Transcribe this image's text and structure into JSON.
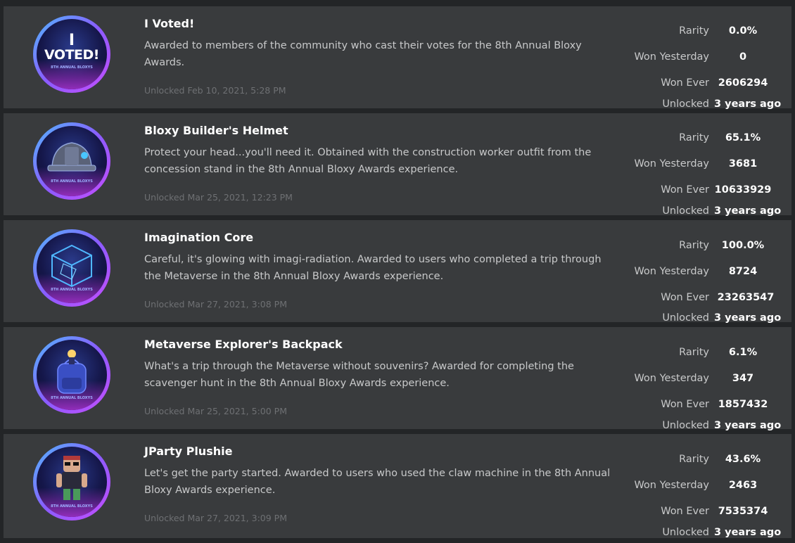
{
  "badges": [
    {
      "title": "I Voted!",
      "description": "Awarded to members of the community who cast their votes for the 8th Annual Bloxy Awards.",
      "unlocked_at": "Unlocked Feb 10, 2021, 5:28 PM",
      "icon": "voted-badge-icon",
      "icon_text_top": "I",
      "icon_text_main": "VOTED!",
      "icon_text_sub": "8TH ANNUAL BLOXYS",
      "stats": {
        "rarity_label": "Rarity",
        "rarity": "0.0%",
        "won_yesterday_label": "Won Yesterday",
        "won_yesterday": "0",
        "won_ever_label": "Won Ever",
        "won_ever": "2606294",
        "unlocked_label": "Unlocked",
        "unlocked": "3 years ago"
      }
    },
    {
      "title": "Bloxy Builder's Helmet",
      "description": "Protect your head...you'll need it. Obtained with the construction worker outfit from the concession stand in the 8th Annual Bloxy Awards experience.",
      "unlocked_at": "Unlocked Mar 25, 2021, 12:23 PM",
      "icon": "helmet-badge-icon",
      "icon_text_sub": "8TH ANNUAL BLOXYS",
      "stats": {
        "rarity_label": "Rarity",
        "rarity": "65.1%",
        "won_yesterday_label": "Won Yesterday",
        "won_yesterday": "3681",
        "won_ever_label": "Won Ever",
        "won_ever": "10633929",
        "unlocked_label": "Unlocked",
        "unlocked": "3 years ago"
      }
    },
    {
      "title": "Imagination Core",
      "description": "Careful, it's glowing with imagi-radiation. Awarded to users who completed a trip through the Metaverse in the 8th Annual Bloxy Awards experience.",
      "unlocked_at": "Unlocked Mar 27, 2021, 3:08 PM",
      "icon": "cube-badge-icon",
      "icon_text_sub": "8TH ANNUAL BLOXYS",
      "stats": {
        "rarity_label": "Rarity",
        "rarity": "100.0%",
        "won_yesterday_label": "Won Yesterday",
        "won_yesterday": "8724",
        "won_ever_label": "Won Ever",
        "won_ever": "23263547",
        "unlocked_label": "Unlocked",
        "unlocked": "3 years ago"
      }
    },
    {
      "title": "Metaverse Explorer's Backpack",
      "description": "What's a trip through the Metaverse without souvenirs? Awarded for completing the scavenger hunt in the 8th Annual Bloxy Awards experience.",
      "unlocked_at": "Unlocked Mar 25, 2021, 5:00 PM",
      "icon": "backpack-badge-icon",
      "icon_text_sub": "8TH ANNUAL BLOXYS",
      "stats": {
        "rarity_label": "Rarity",
        "rarity": "6.1%",
        "won_yesterday_label": "Won Yesterday",
        "won_yesterday": "347",
        "won_ever_label": "Won Ever",
        "won_ever": "1857432",
        "unlocked_label": "Unlocked",
        "unlocked": "3 years ago"
      }
    },
    {
      "title": "JParty Plushie",
      "description": "Let's get the party started. Awarded to users who used the claw machine in the 8th Annual Bloxy Awards experience.",
      "unlocked_at": "Unlocked Mar 27, 2021, 3:09 PM",
      "icon": "plushie-badge-icon",
      "icon_text_sub": "8TH ANNUAL BLOXYS",
      "stats": {
        "rarity_label": "Rarity",
        "rarity": "43.6%",
        "won_yesterday_label": "Won Yesterday",
        "won_yesterday": "2463",
        "won_ever_label": "Won Ever",
        "won_ever": "7535374",
        "unlocked_label": "Unlocked",
        "unlocked": "3 years ago"
      }
    }
  ]
}
